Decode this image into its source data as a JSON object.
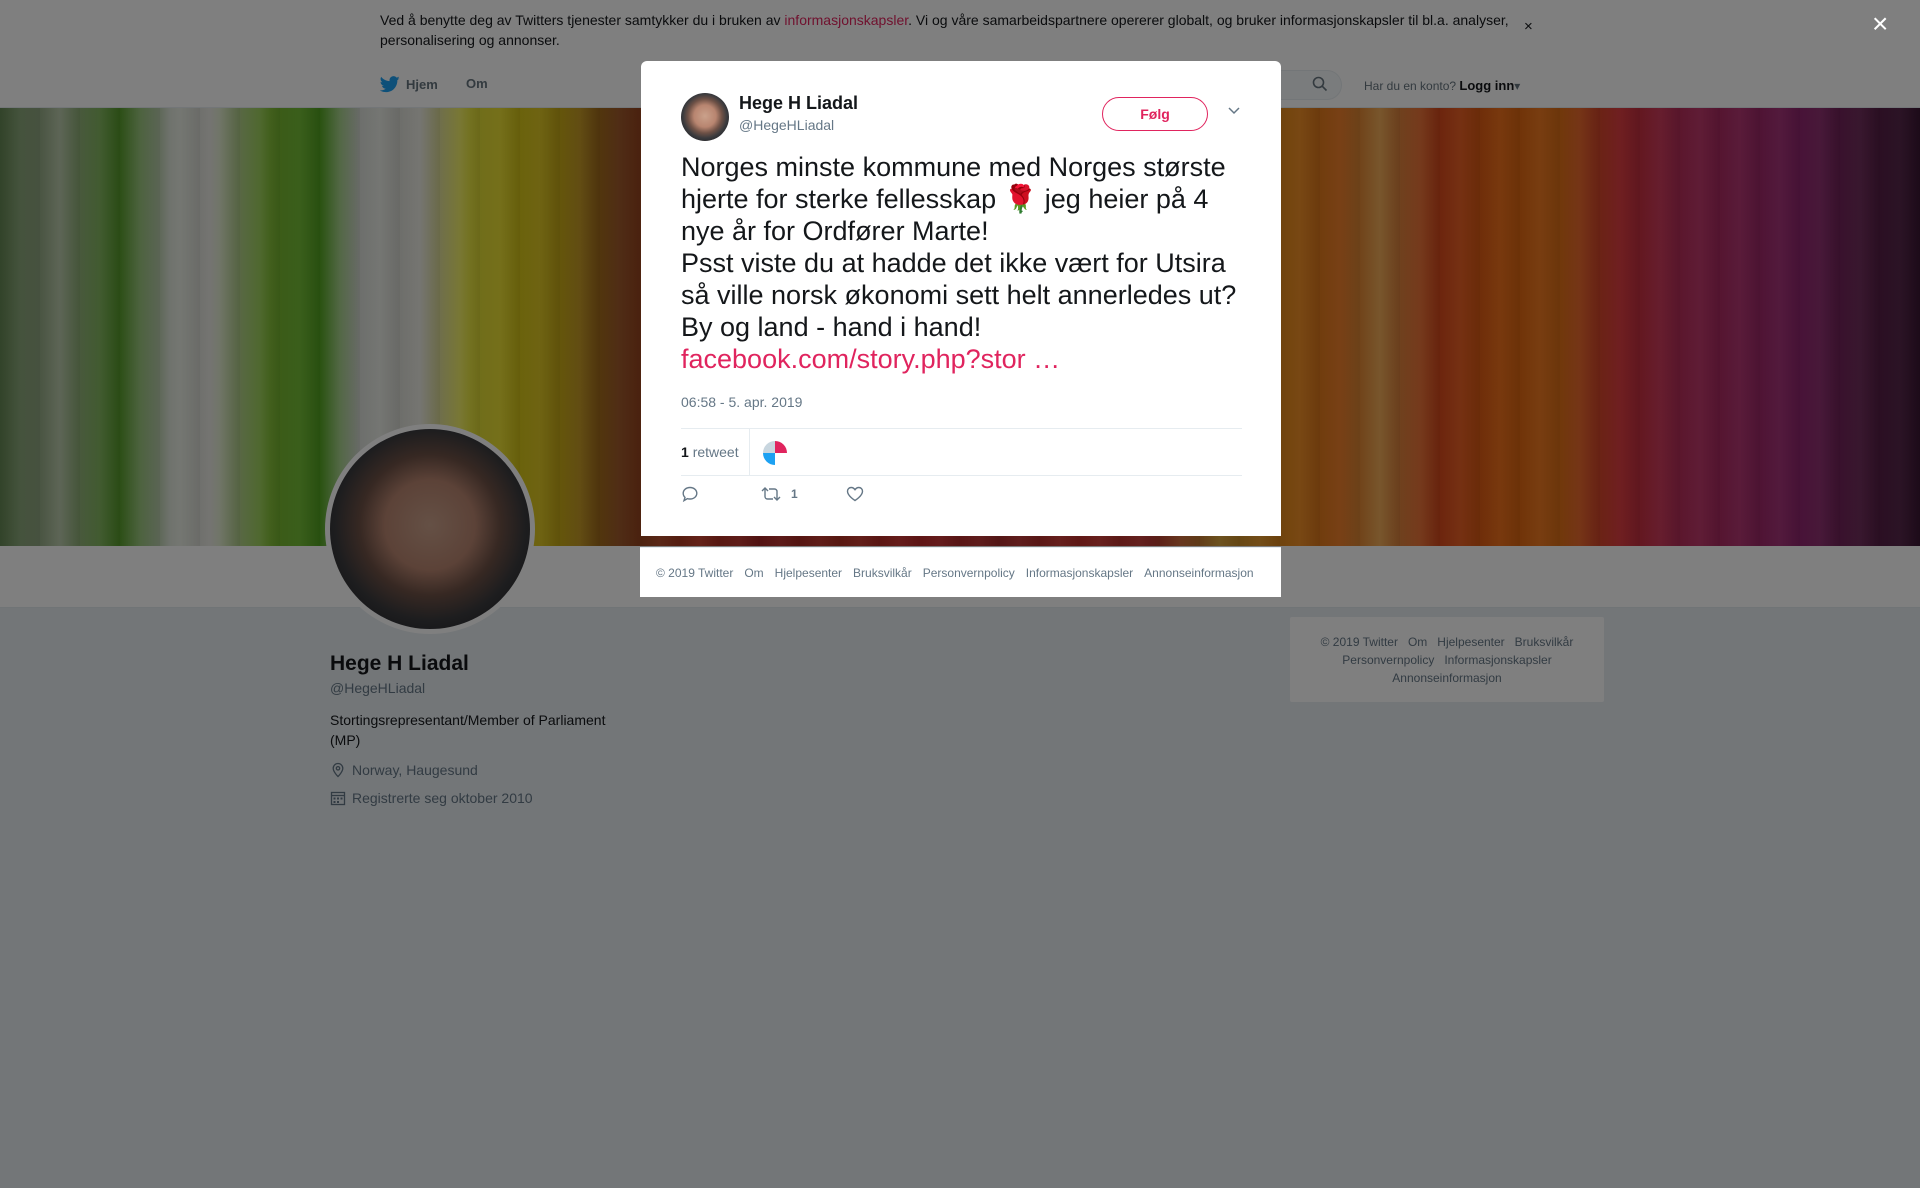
{
  "cookie_banner": {
    "text_before": "Ved å benytte deg av Twitters tjenester samtykker du i bruken av ",
    "link": "informasjonskapsler",
    "text_after": ". Vi og våre samarbeidspartnere opererer globalt, og bruker informasjonskapsler til bl.a. analyser, personalisering og annonser.",
    "close": "×"
  },
  "nav": {
    "home": "Hjem",
    "about": "Om",
    "login_question": "Har du en konto?",
    "login": "Logg inn"
  },
  "profile": {
    "name": "Hege H Liadal",
    "handle": "@HegeHLiadal",
    "bio": "Stortingsrepresentant/Member of Parliament (MP)",
    "location": "Norway, Haugesund",
    "joined": "Registrerte seg oktober 2010"
  },
  "side_footer": {
    "items": [
      "© 2019 Twitter",
      "Om",
      "Hjelpesenter",
      "Bruksvilkår",
      "Personvernpolicy",
      "Informasjonskapsler",
      "Annonseinformasjon"
    ]
  },
  "overlay": {
    "close": "×"
  },
  "tweet": {
    "name": "Hege H Liadal",
    "handle": "@HegeHLiadal",
    "follow": "Følg",
    "text_1": "Norges minste kommune med Norges største hjerte for sterke fellesskap ",
    "emoji": "🌹",
    "text_2": " jeg heier på 4 nye år for Ordfører Marte!\nPsst viste du at hadde det ikke vært for Utsira så ville norsk økonomi sett helt annerledes ut? By og land - hand i hand!\n",
    "link": " facebook.com/story.php?stor …",
    "time": "06:58 - 5. apr. 2019",
    "retweet_count": "1",
    "retweet_label": "retweet",
    "action_retweet_count": "1"
  },
  "modal_footer": {
    "items": [
      "© 2019 Twitter",
      "Om",
      "Hjelpesenter",
      "Bruksvilkår",
      "Personvernpolicy",
      "Informasjonskapsler",
      "Annonseinformasjon"
    ]
  },
  "colors": {
    "accent": "#e0245e",
    "twitter_blue": "#1da1f2",
    "muted": "#657786"
  }
}
